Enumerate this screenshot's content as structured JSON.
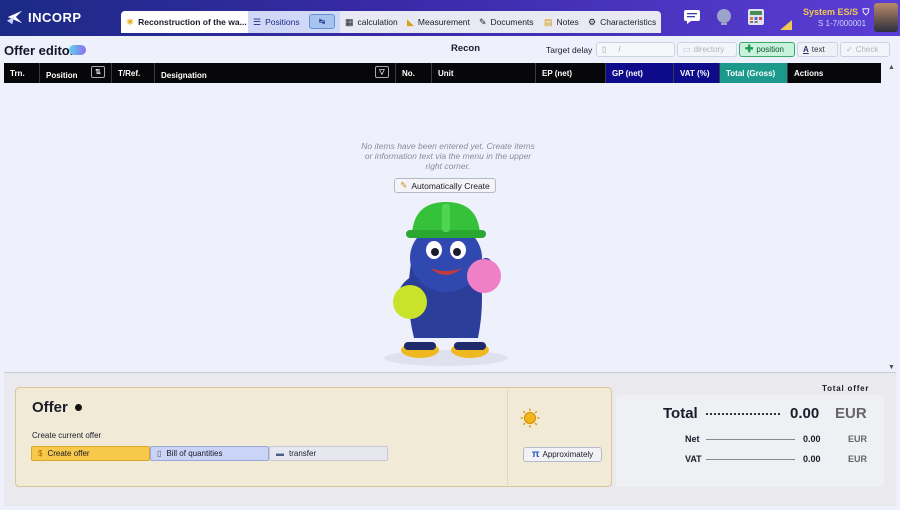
{
  "app": {
    "brand": "INCORP"
  },
  "tabs": {
    "project": "Reconstruction of the wa...",
    "positions": "Positions",
    "positions_badge": "↹",
    "calculation": "calculation",
    "measurement": "Measurement",
    "documents": "Documents",
    "notes": "Notes",
    "characteristics": "Characteristics"
  },
  "header": {
    "company": "System ES/S",
    "company_sub": "S 1-7/000001"
  },
  "editor": {
    "title": "Offer editor",
    "recon_label": "Recon",
    "target_delay_label": "Target delay",
    "target_delay_value": "/",
    "directory_label": "directory",
    "position_label": "position",
    "text_label": "text",
    "check_label": "Check"
  },
  "table": {
    "columns": {
      "trn": "Trn.",
      "position": "Position",
      "tref": "T/Ref.",
      "designation": "Designation",
      "no": "No.",
      "unit": "Unit",
      "ep": "EP (net)",
      "gp": "GP (net)",
      "vat": "VAT (%)",
      "total": "Total (Gross)",
      "actions": "Actions"
    },
    "position_btn": "⇅",
    "designation_btn": "▽"
  },
  "empty_state": {
    "message": "No items have been entered yet. Create items or information text via the menu in the upper right corner.",
    "auto_create": "Automatically Create"
  },
  "offer": {
    "title": "Offer",
    "create_label": "Create current offer",
    "create_btn": "Create offer",
    "boq_btn": "Bill of quantities",
    "transfer_btn": "transfer",
    "approx_btn": "Approximately"
  },
  "totals": {
    "heading": "Total offer",
    "total_label": "Total",
    "total_value": "0.00",
    "currency": "EUR",
    "net_label": "Net",
    "net_value": "0.00",
    "vat_label": "VAT",
    "vat_value": "0.00"
  },
  "colors": {
    "header_start": "#1c2a86",
    "header_end": "#5b3ed6",
    "accent_teal": "#1b9a8b",
    "accent_navy": "#0e0a8c",
    "create_yellow": "#f7c94b"
  }
}
